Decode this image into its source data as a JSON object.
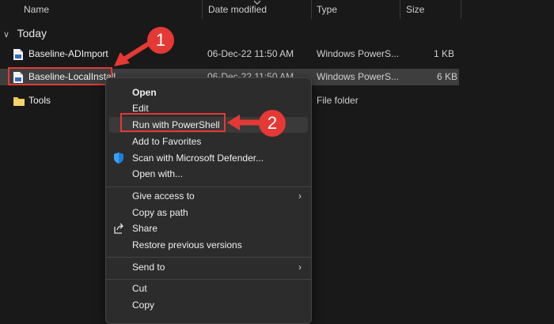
{
  "columns": {
    "name": "Name",
    "date": "Date modified",
    "type": "Type",
    "size": "Size"
  },
  "group": {
    "label": "Today"
  },
  "files": [
    {
      "name": "Baseline-ADImport",
      "date": "06-Dec-22 11:50 AM",
      "type": "Windows PowerS...",
      "size": "1 KB",
      "icon": "powershell-script-icon"
    },
    {
      "name": "Baseline-LocalInstall",
      "date": "06-Dec-22 11:50 AM",
      "type": "Windows PowerS...",
      "size": "6 KB",
      "icon": "powershell-script-icon"
    },
    {
      "name": "Tools",
      "date": "",
      "type": "File folder",
      "size": "",
      "icon": "folder-icon"
    }
  ],
  "context_menu": {
    "open": "Open",
    "edit": "Edit",
    "run_ps": "Run with PowerShell",
    "favorites": "Add to Favorites",
    "defender": "Scan with Microsoft Defender...",
    "open_with": "Open with...",
    "give_access": "Give access to",
    "copy_path": "Copy as path",
    "share": "Share",
    "restore": "Restore previous versions",
    "send_to": "Send to",
    "cut": "Cut",
    "copy": "Copy"
  },
  "annotations": {
    "step1": "1",
    "step2": "2"
  },
  "colors": {
    "accent_red": "#e53935",
    "background": "#191919",
    "menu_bg": "#2c2c2c",
    "selection": "#3e3e3e"
  }
}
